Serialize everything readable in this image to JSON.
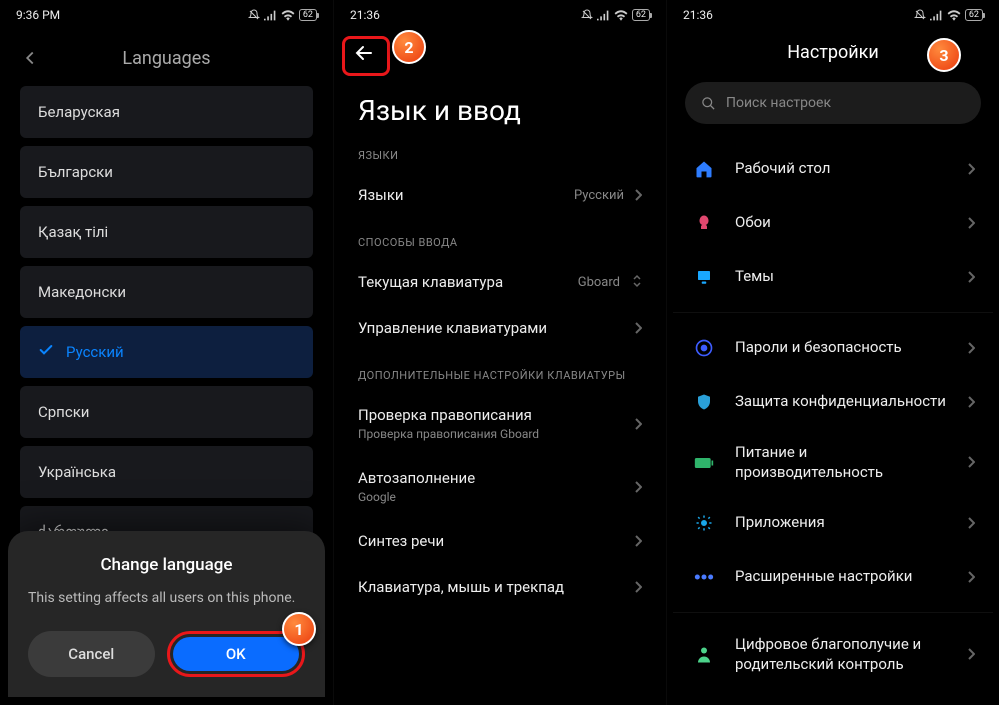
{
  "phone1": {
    "time": "9:36 PM",
    "battery": "62",
    "title": "Languages",
    "languages": [
      "Беларуская",
      "Български",
      "Қазақ тілі",
      "Македонски",
      "Русский",
      "Српски",
      "Українська",
      "ქართული"
    ],
    "selected_index": 4,
    "dialog": {
      "title": "Change language",
      "body": "This setting affects all users on this phone.",
      "cancel": "Cancel",
      "ok": "OK"
    }
  },
  "phone2": {
    "time": "21:36",
    "battery": "62",
    "title": "Язык и ввод",
    "sec_lang": "ЯЗЫКИ",
    "row_lang": "Языки",
    "row_lang_val": "Русский",
    "sec_input": "СПОСОБЫ ВВОДА",
    "row_kb": "Текущая клавиатура",
    "row_kb_val": "Gboard",
    "row_manage": "Управление клавиатурами",
    "sec_extra": "ДОПОЛНИТЕЛЬНЫЕ НАСТРОЙКИ КЛАВИАТУРЫ",
    "row_spell": "Проверка правописания",
    "row_spell_sub": "Проверка правописания Gboard",
    "row_autofill": "Автозаполнение",
    "row_autofill_sub": "Google",
    "row_tts": "Синтез речи",
    "row_mouse": "Клавиатура, мышь и трекпад"
  },
  "phone3": {
    "time": "21:36",
    "battery": "62",
    "title": "Настройки",
    "search_placeholder": "Поиск настроек",
    "items": [
      {
        "icon": "home",
        "label": "Рабочий стол",
        "color": "#2e7dff"
      },
      {
        "icon": "wallpaper",
        "label": "Обои",
        "color": "#e0476e"
      },
      {
        "icon": "themes",
        "label": "Темы",
        "color": "#19a7ff"
      },
      {
        "sep": true
      },
      {
        "icon": "lock",
        "label": "Пароли и безопасность",
        "color": "#3d5cff"
      },
      {
        "icon": "privacy",
        "label": "Защита конфиденциальности",
        "color": "#2aa0d8"
      },
      {
        "icon": "battery",
        "label": "Питание и производительность",
        "color": "#2fb46b"
      },
      {
        "icon": "apps",
        "label": "Приложения",
        "color": "#1aa6e8"
      },
      {
        "icon": "more",
        "label": "Расширенные настройки",
        "color": "#4a7bff"
      },
      {
        "sep": true
      },
      {
        "icon": "wellbeing",
        "label": "Цифровое благополучие и родительский контроль",
        "color": "#4cd28a"
      }
    ]
  },
  "annotations": {
    "a1": "1",
    "a2": "2",
    "a3": "3"
  }
}
